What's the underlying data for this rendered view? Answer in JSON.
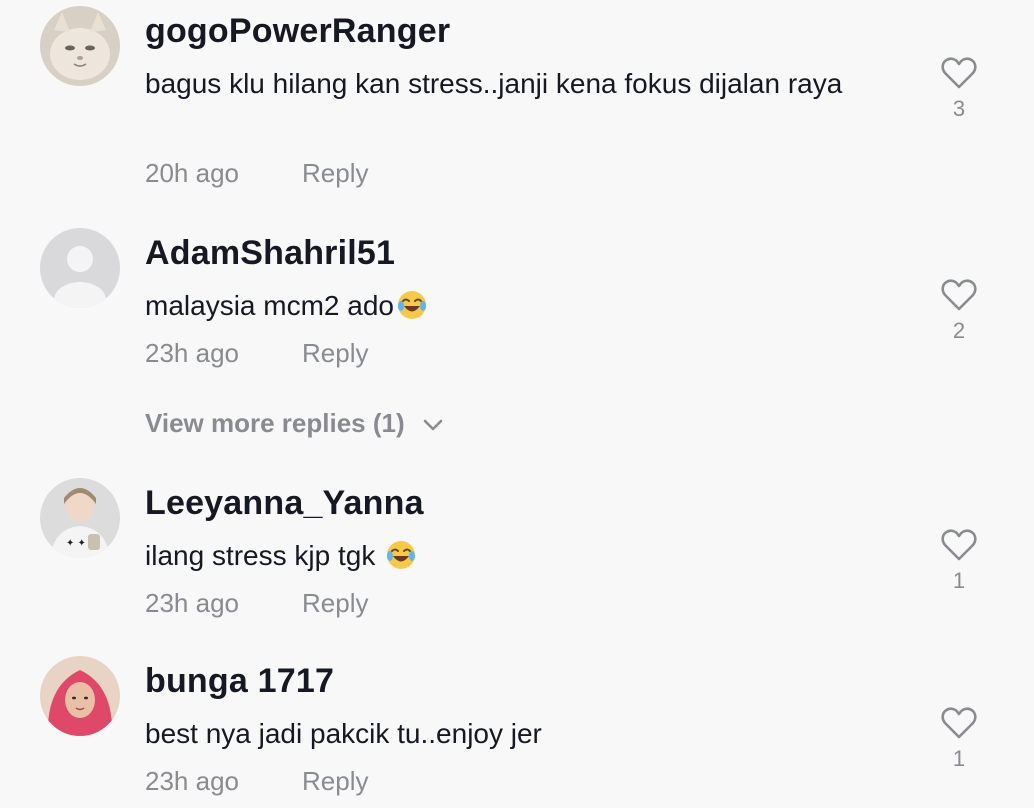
{
  "comments": [
    {
      "username": "gogoPowerRanger",
      "text": "bagus klu hilang kan stress..janji kena fokus dijalan raya",
      "time": "20h ago",
      "reply_label": "Reply",
      "likes": "3",
      "avatar": "cat-photo"
    },
    {
      "username": "AdamShahril51",
      "text": "malaysia mcm2 ado",
      "emoji": "face-with-tears-of-joy",
      "time": "23h ago",
      "reply_label": "Reply",
      "likes": "2",
      "avatar": "default-avatar",
      "view_more_label": "View more replies (1)"
    },
    {
      "username": "Leeyanna_Yanna",
      "text": "ilang stress kjp tgk ",
      "emoji": "face-with-tears-of-joy",
      "time": "23h ago",
      "reply_label": "Reply",
      "likes": "1",
      "avatar": "woman-photo"
    },
    {
      "username": "bunga 1717",
      "text": "best nya jadi pakcik tu..enjoy jer",
      "time": "23h ago",
      "reply_label": "Reply",
      "likes": "1",
      "avatar": "woman-hijab-photo"
    }
  ],
  "colors": {
    "background": "#f8f8f8",
    "primary_text": "#161823",
    "secondary_text": "#8a8b91"
  }
}
